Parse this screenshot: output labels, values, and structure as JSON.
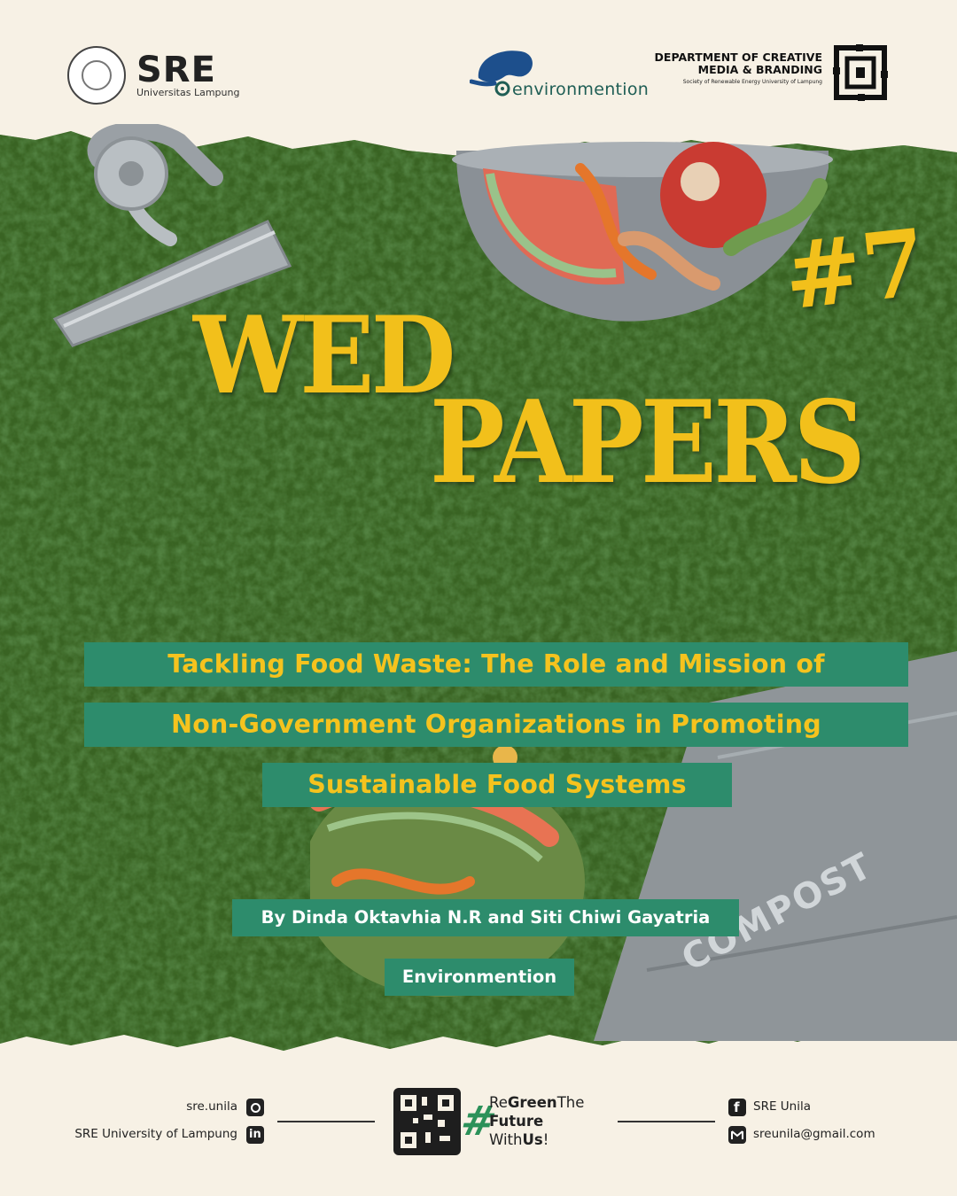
{
  "header": {
    "sre_logo": "SRE",
    "sre_subtitle": "Universitas Lampung",
    "env_logo": "environmention",
    "dept_title": "DEPARTMENT OF CREATIVE MEDIA & BRANDING",
    "dept_subtitle": "Society of Renewable Energy University of Lampung"
  },
  "title": {
    "word1": "WED",
    "word2": "PAPERS",
    "issue": "#7"
  },
  "article": {
    "headline_lines": [
      "Tackling Food Waste: The Role and Mission of",
      "Non-Government Organizations in Promoting",
      "Sustainable Food Systems"
    ],
    "byline": "By Dinda Oktavhia N.R and Siti Chiwi Gayatria",
    "category": "Environmention"
  },
  "scene": {
    "compost_label": "COMPOST"
  },
  "footer": {
    "instagram": "sre.unila",
    "linkedin": "SRE University of Lampung",
    "facebook": "SRE Unila",
    "email": "sreunila@gmail.com",
    "slogan_hash": "#",
    "slogan_line1_a": "Re",
    "slogan_line1_b": "Green",
    "slogan_line1_c": "The",
    "slogan_line2": "Future",
    "slogan_line3_a": "With",
    "slogan_line3_b": "Us",
    "slogan_line3_c": "!"
  },
  "colors": {
    "background": "#f7f1e5",
    "grass": "#3f6b26",
    "title_yellow": "#f2c01b",
    "label_green": "#2d8c6c",
    "slogan_green": "#2b9159"
  }
}
